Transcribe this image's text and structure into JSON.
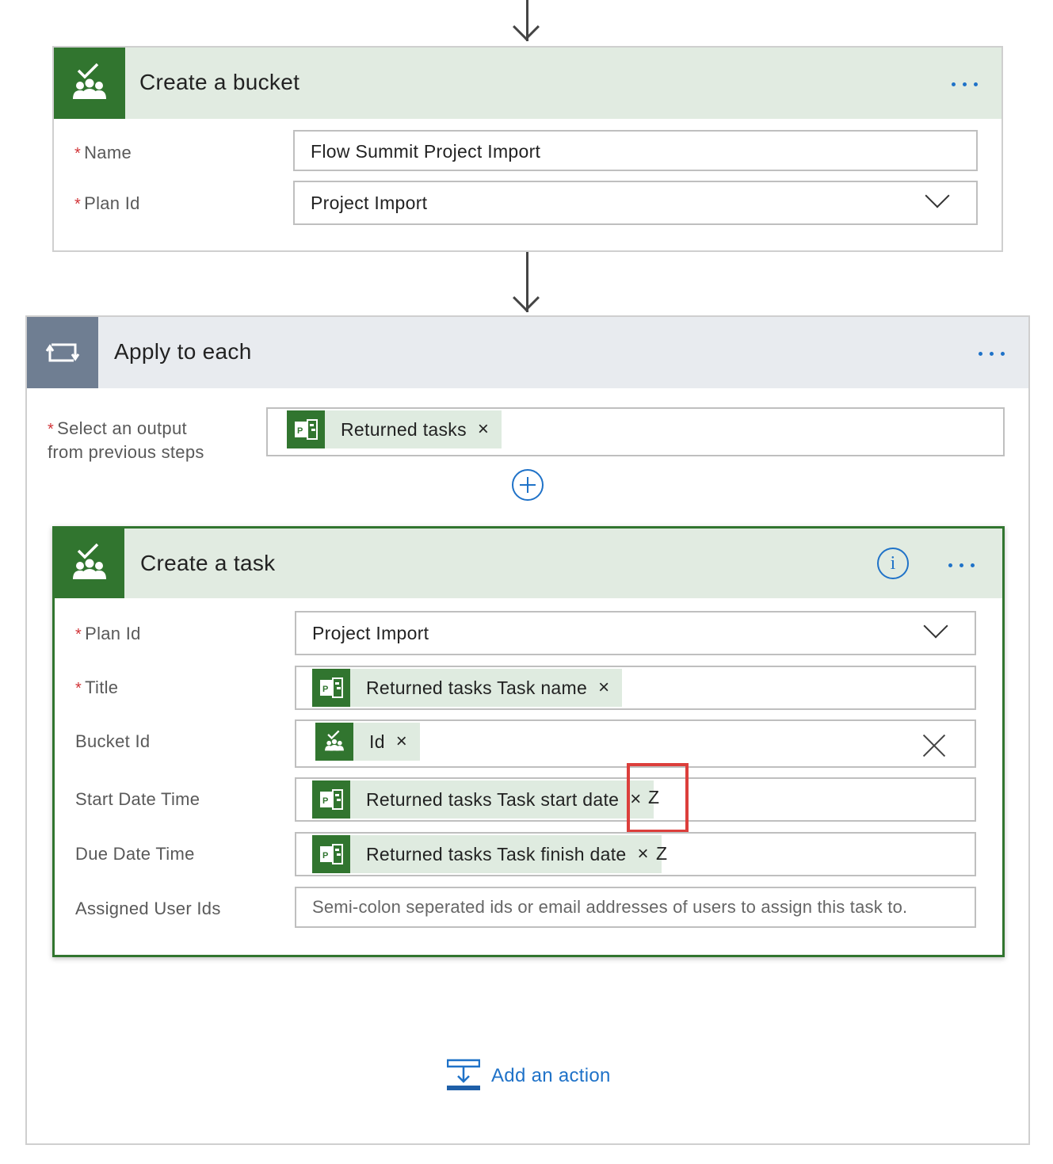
{
  "colors": {
    "planner_green": "#31752f",
    "header_green_bg": "#e1ebe1",
    "loop_header_bg": "#e8ebef",
    "loop_icon_bg": "#6f7e92",
    "accent_blue": "#1f72c8",
    "required_red": "#d13438",
    "highlight_red": "#dc3f3c",
    "token_bg": "#dfebe0"
  },
  "create_bucket": {
    "title": "Create a bucket",
    "icon": "planner-icon",
    "name_label": "Name",
    "name_value": "Flow Summit Project Import",
    "plan_label": "Plan Id",
    "plan_value": "Project Import"
  },
  "apply_each": {
    "title": "Apply to each",
    "icon": "loop-icon",
    "select_label_line1": "Select an output",
    "select_label_line2": "from previous steps",
    "select_token": "Returned tasks"
  },
  "create_task": {
    "title": "Create a task",
    "icon": "planner-icon",
    "plan_label": "Plan Id",
    "plan_value": "Project Import",
    "title_label": "Title",
    "title_token": "Returned tasks Task name",
    "bucket_label": "Bucket Id",
    "bucket_token": "Id",
    "start_label": "Start Date Time",
    "start_token": "Returned tasks Task start date",
    "start_suffix": "Z",
    "due_label": "Due Date Time",
    "due_token": "Returned tasks Task finish date",
    "due_suffix": "Z",
    "assigned_label": "Assigned User Ids",
    "assigned_placeholder": "Semi-colon seperated ids or email addresses of users to assign this task to."
  },
  "add_action": {
    "label": "Add an action"
  }
}
